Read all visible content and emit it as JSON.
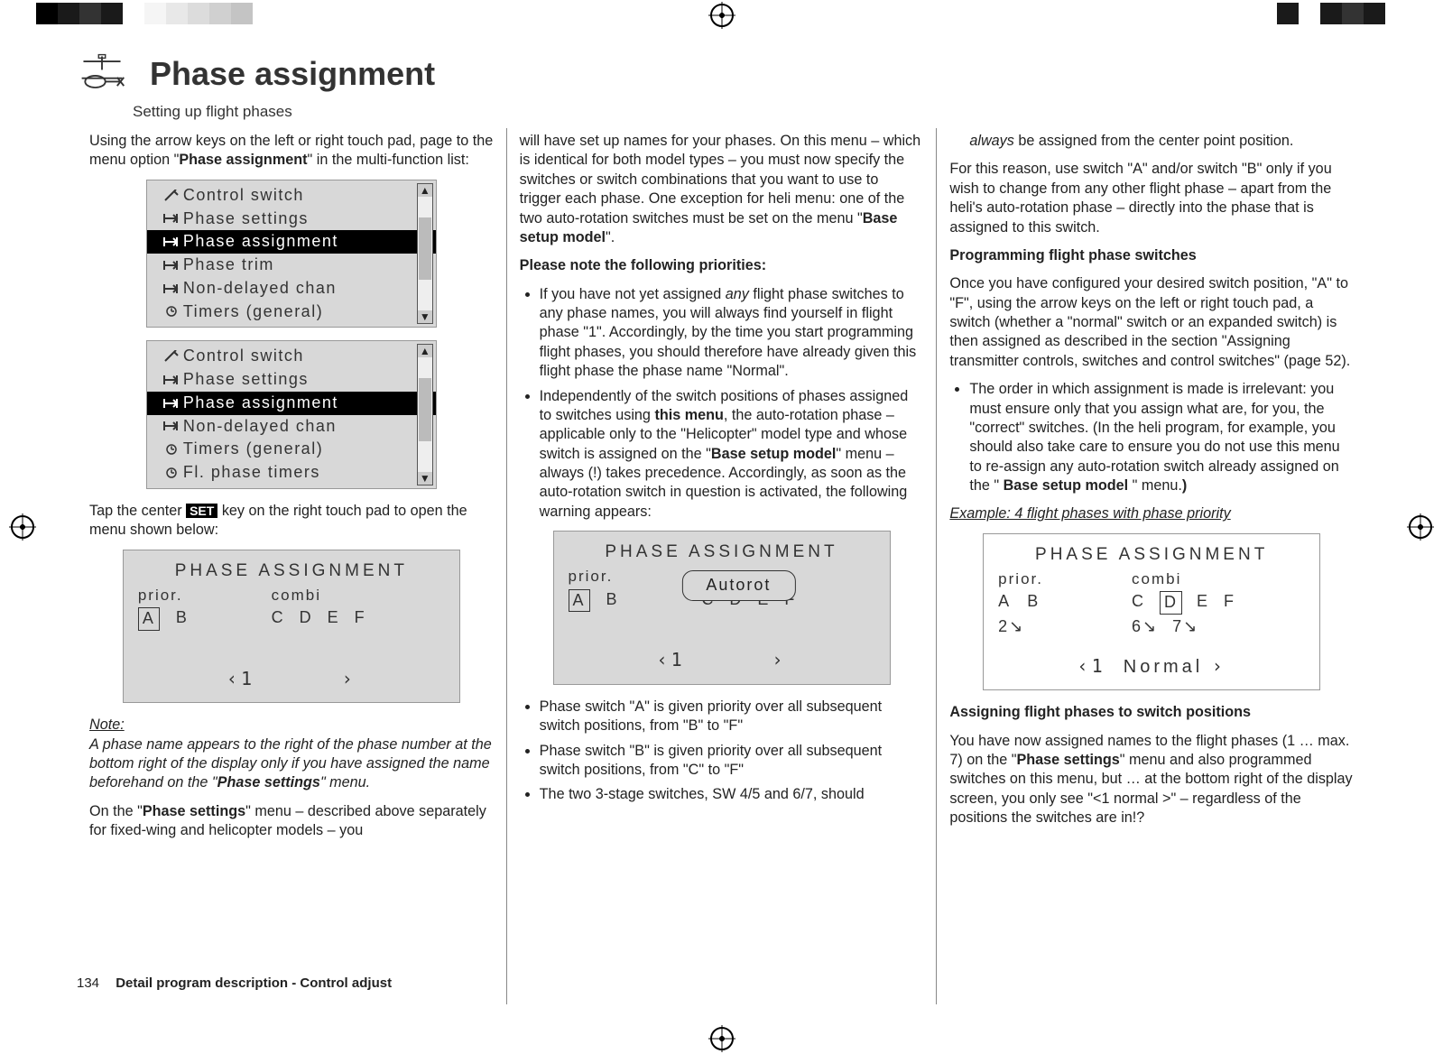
{
  "print_colors": [
    "#000000",
    "#1a1a1a",
    "#333333",
    "#1a1a1a",
    "#ffffff",
    "#f5f5f5",
    "#e8e8e8",
    "#dcdcdc",
    "#d0d0d0",
    "#c4c4c4",
    "#1a1a1a",
    "#ffffff",
    "#1a1a1a",
    "#333333",
    "#1a1a1a",
    "#ffffff"
  ],
  "header": {
    "title": "Phase assignment",
    "subtitle": "Setting up flight phases"
  },
  "col1": {
    "intro_1": "Using the arrow keys on the left or right touch pad, page to the menu option \"",
    "intro_bold": "Phase assignment",
    "intro_2": "\" in the multi-function list:",
    "menu1": {
      "items": [
        {
          "icon": "tool",
          "label": "Control switch",
          "selected": false
        },
        {
          "icon": "arrow",
          "label": "Phase settings",
          "selected": false
        },
        {
          "icon": "arrow",
          "label": "Phase assignment",
          "selected": true
        },
        {
          "icon": "arrow",
          "label": "Phase trim",
          "selected": false
        },
        {
          "icon": "arrow",
          "label": "Non-delayed chan",
          "selected": false
        },
        {
          "icon": "clock",
          "label": "Timers (general)",
          "selected": false
        }
      ],
      "thumb_top": "18%",
      "thumb_height": "55%"
    },
    "menu2": {
      "items": [
        {
          "icon": "tool",
          "label": "Control switch",
          "selected": false
        },
        {
          "icon": "arrow",
          "label": "Phase settings",
          "selected": false
        },
        {
          "icon": "arrow",
          "label": "Phase assignment",
          "selected": true
        },
        {
          "icon": "arrow",
          "label": "Non-delayed chan",
          "selected": false
        },
        {
          "icon": "clock",
          "label": "Timers (general)",
          "selected": false
        },
        {
          "icon": "clock",
          "label": "Fl. phase timers",
          "selected": false
        }
      ],
      "thumb_top": "18%",
      "thumb_height": "55%"
    },
    "tap_1": "Tap the center ",
    "tap_set": "SET",
    "tap_2": " key on the right touch pad to open the menu shown below:",
    "lcd1": {
      "title": "PHASE  ASSIGNMENT",
      "prior": "prior.",
      "combi": "combi",
      "letters_left": [
        "A",
        "B"
      ],
      "letters_right": [
        "C",
        "D",
        "E",
        "F"
      ],
      "boxed_left_index": 0,
      "status_prefix": "‹1",
      "status_name": "",
      "status_suffix": "›"
    },
    "note_head": "Note:",
    "note_body_1": "A phase name appears to the right of the phase number at the bottom right of the display only if you have assigned the name beforehand on the \"",
    "note_body_bold": "Phase settings",
    "note_body_2": "\" menu.",
    "tail_1": "On the \"",
    "tail_bold": "Phase settings",
    "tail_2": "\" menu – described above separately for fixed-wing and helicopter models – you"
  },
  "col2": {
    "p1_a": "will have set up names for your phases. On this menu – which is identical for both model types – you must now specify the switches or switch combinations that you want to use to trigger each phase. One exception for heli menu: one of the two auto-rotation switches must be set on the menu \"",
    "p1_bold": "Base setup model",
    "p1_b": "\".",
    "priorities_head": "Please note the following priorities:",
    "b1_a": "If you have not yet assigned ",
    "b1_i": "any",
    "b1_b": " flight phase switches to any phase names, you will always find yourself in flight phase \"1\". Accordingly, by the time you start programming flight phases, you should therefore have already given this flight phase the phase name \"Normal\".",
    "b2_a": "Independently of the switch positions of phases assigned to switches using ",
    "b2_bold1": "this menu",
    "b2_b": ", the auto-rotation phase – applicable only to the \"Helicopter\" model type and whose switch is assigned on the \"",
    "b2_bold2": "Base setup model",
    "b2_c": "\" menu – always (!) takes precedence. Accordingly, as soon as the auto-rotation switch in question is activated, the following warning appears:",
    "lcd2": {
      "title": "PHASE  ASSIGNMENT",
      "prior": "prior.",
      "combi": "combi",
      "letters_left": [
        "A",
        "B"
      ],
      "letters_right": [
        "C",
        "D",
        "E",
        "F"
      ],
      "boxed_left_index": 0,
      "overlay": "Autorot",
      "status_prefix": "‹1",
      "status_suffix": "›"
    },
    "b3": "Phase switch \"A\" is given priority over all subsequent switch positions, from \"B\" to \"F\"",
    "b4": "Phase switch \"B\" is given priority over all subsequent switch positions, from \"C\" to \"F\"",
    "b5": "The two 3-stage switches, SW 4/5 and 6/7, should"
  },
  "col3": {
    "cont_i": "always",
    "cont_a": " be assigned from the center point position.",
    "p1": "For this reason, use switch \"A\" and/or switch \"B\" only if you wish to change from any other flight phase – apart from the heli's auto-rotation phase – directly into the phase that is assigned to this switch.",
    "h1": "Programming flight phase switches",
    "p2": "Once you have configured your desired switch position, \"A\" to \"F\", using the arrow keys on the left or right touch pad, a switch (whether a \"normal\" switch or an expanded switch) is then assigned as described in the section \"Assigning transmitter controls, switches and control switches\" (page 52).",
    "b1_a": "The order in which assignment is made is irrelevant: you must ensure only that you assign what are, for you, the \"correct\" switches. (In the heli program, for example, you should also take care to ensure you do not use this menu to re-assign any auto-rotation switch already assigned on the \"",
    "b1_bold": " Base setup model ",
    "b1_b": "\" menu.",
    "b1_close": ")",
    "example_head": "Example: 4 flight phases with phase priority",
    "lcd3": {
      "title": "PHASE  ASSIGNMENT",
      "prior": "prior.",
      "combi": "combi",
      "row_left": [
        "A",
        "B"
      ],
      "row_right": [
        "C",
        "D",
        "E",
        "F"
      ],
      "boxed_right_index": 1,
      "sw_left": [
        "2↘",
        ""
      ],
      "sw_right": [
        "6↘",
        "7↘",
        "",
        ""
      ],
      "status_prefix": "‹1",
      "status_name": "Normal",
      "status_suffix": "›"
    },
    "h2": "Assigning flight phases to switch positions",
    "p3_a": "You have now assigned names to the flight phases (1 … max. 7) on the \"",
    "p3_bold": "Phase settings",
    "p3_b": "\" menu and also programmed switches on this menu, but … at the bottom right of the display screen, you only see \"<1 normal >\" – regardless of the positions the switches are in!?"
  },
  "footer": {
    "page_number": "134",
    "section": "Detail program description - Control adjust"
  }
}
